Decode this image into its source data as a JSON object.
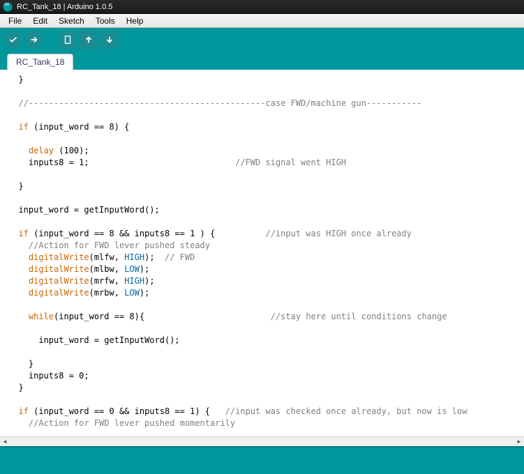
{
  "window": {
    "title": "RC_Tank_18 | Arduino 1.0.5"
  },
  "menu": {
    "file": "File",
    "edit": "Edit",
    "sketch": "Sketch",
    "tools": "Tools",
    "help": "Help"
  },
  "toolbar": {
    "verify": "verify",
    "upload": "upload",
    "new": "new",
    "open": "open",
    "save": "save"
  },
  "tabs": {
    "active": "RC_Tank_18"
  },
  "code": {
    "lines": [
      {
        "indent": 1,
        "segs": [
          {
            "t": "}",
            "c": ""
          }
        ]
      },
      {
        "indent": 1,
        "segs": []
      },
      {
        "indent": 1,
        "segs": [
          {
            "t": "//-----------------------------------------------case FWD/machine gun-----------",
            "c": "cm"
          }
        ]
      },
      {
        "indent": 1,
        "segs": []
      },
      {
        "indent": 1,
        "segs": [
          {
            "t": "if",
            "c": "kw"
          },
          {
            "t": " (input_word == 8) {",
            "c": ""
          }
        ]
      },
      {
        "indent": 1,
        "segs": []
      },
      {
        "indent": 2,
        "segs": [
          {
            "t": "delay",
            "c": "fn"
          },
          {
            "t": " (100);",
            "c": ""
          }
        ]
      },
      {
        "indent": 2,
        "segs": [
          {
            "t": "inputs8 = 1;                             ",
            "c": ""
          },
          {
            "t": "//FWD signal went HIGH",
            "c": "cm"
          }
        ]
      },
      {
        "indent": 1,
        "segs": []
      },
      {
        "indent": 1,
        "segs": [
          {
            "t": "}",
            "c": ""
          }
        ]
      },
      {
        "indent": 1,
        "segs": []
      },
      {
        "indent": 1,
        "segs": [
          {
            "t": "input_word = getInputWord();",
            "c": ""
          }
        ]
      },
      {
        "indent": 1,
        "segs": []
      },
      {
        "indent": 1,
        "segs": [
          {
            "t": "if",
            "c": "kw"
          },
          {
            "t": " (input_word == 8 && inputs8 == 1 ) {          ",
            "c": ""
          },
          {
            "t": "//input was HIGH once already",
            "c": "cm"
          }
        ]
      },
      {
        "indent": 2,
        "segs": [
          {
            "t": "//Action for FWD lever pushed steady",
            "c": "cm"
          }
        ]
      },
      {
        "indent": 2,
        "segs": [
          {
            "t": "digitalWrite",
            "c": "fn"
          },
          {
            "t": "(mlfw, ",
            "c": ""
          },
          {
            "t": "HIGH",
            "c": "cn"
          },
          {
            "t": ");  ",
            "c": ""
          },
          {
            "t": "// FWD",
            "c": "cm"
          }
        ]
      },
      {
        "indent": 2,
        "segs": [
          {
            "t": "digitalWrite",
            "c": "fn"
          },
          {
            "t": "(mlbw, ",
            "c": ""
          },
          {
            "t": "LOW",
            "c": "cn"
          },
          {
            "t": ");",
            "c": ""
          }
        ]
      },
      {
        "indent": 2,
        "segs": [
          {
            "t": "digitalWrite",
            "c": "fn"
          },
          {
            "t": "(mrfw, ",
            "c": ""
          },
          {
            "t": "HIGH",
            "c": "cn"
          },
          {
            "t": ");",
            "c": ""
          }
        ]
      },
      {
        "indent": 2,
        "segs": [
          {
            "t": "digitalWrite",
            "c": "fn"
          },
          {
            "t": "(mrbw, ",
            "c": ""
          },
          {
            "t": "LOW",
            "c": "cn"
          },
          {
            "t": ");",
            "c": ""
          }
        ]
      },
      {
        "indent": 1,
        "segs": []
      },
      {
        "indent": 2,
        "segs": [
          {
            "t": "while",
            "c": "kw"
          },
          {
            "t": "(input_word == 8){                         ",
            "c": ""
          },
          {
            "t": "//stay here until conditions change",
            "c": "cm"
          }
        ]
      },
      {
        "indent": 1,
        "segs": []
      },
      {
        "indent": 3,
        "segs": [
          {
            "t": "input_word = getInputWord();",
            "c": ""
          }
        ]
      },
      {
        "indent": 1,
        "segs": []
      },
      {
        "indent": 2,
        "segs": [
          {
            "t": "}",
            "c": ""
          }
        ]
      },
      {
        "indent": 2,
        "segs": [
          {
            "t": "inputs8 = 0;",
            "c": ""
          }
        ]
      },
      {
        "indent": 1,
        "segs": [
          {
            "t": "}",
            "c": ""
          }
        ]
      },
      {
        "indent": 1,
        "segs": []
      },
      {
        "indent": 1,
        "segs": [
          {
            "t": "if",
            "c": "kw"
          },
          {
            "t": " (input_word == 0 && inputs8 == 1) {   ",
            "c": ""
          },
          {
            "t": "//input was checked once already, but now is low",
            "c": "cm"
          }
        ]
      },
      {
        "indent": 2,
        "segs": [
          {
            "t": "//Action for FWD lever pushed momentarily",
            "c": "cm"
          }
        ]
      }
    ]
  }
}
